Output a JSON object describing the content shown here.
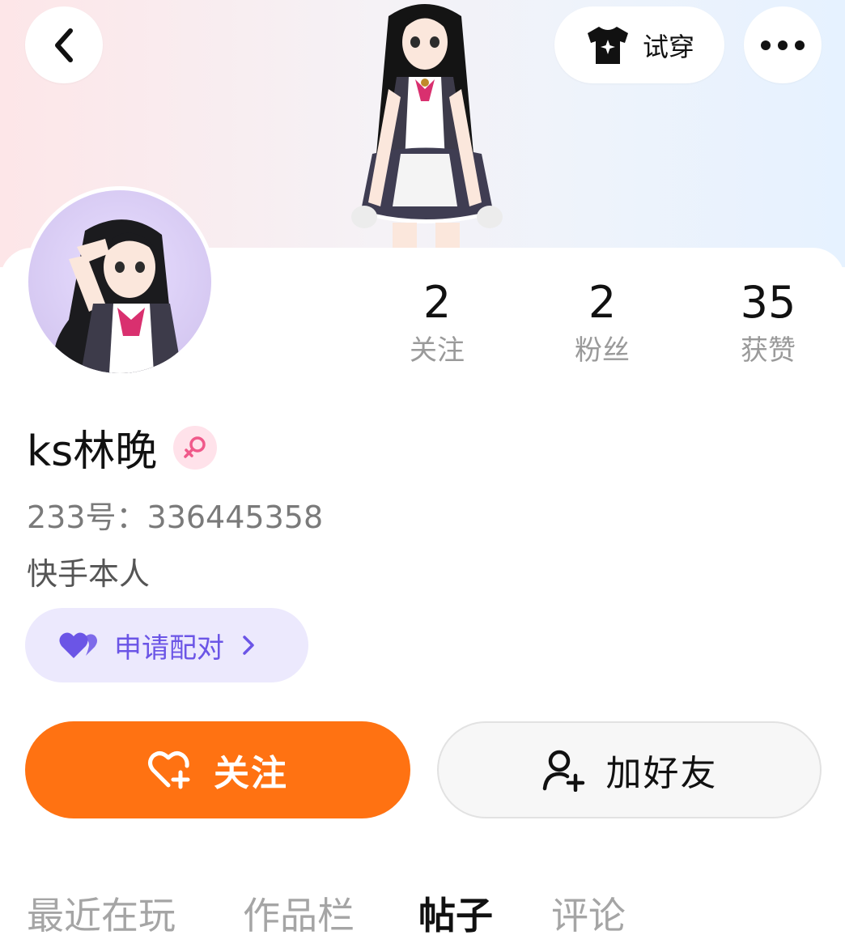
{
  "header": {
    "try_on_label": "试穿"
  },
  "stats": [
    {
      "value": "2",
      "label": "关注"
    },
    {
      "value": "2",
      "label": "粉丝"
    },
    {
      "value": "35",
      "label": "获赞"
    }
  ],
  "profile": {
    "username": "ks林晚",
    "uid_line": "233号：336445358",
    "bio": "快手本人"
  },
  "pair_chip": {
    "label": "申请配对"
  },
  "actions": {
    "follow_label": "关注",
    "add_friend_label": "加好友"
  },
  "tabs": [
    {
      "label": "最近在玩"
    },
    {
      "label": "作品栏"
    },
    {
      "label": "帖子"
    },
    {
      "label": "评论"
    }
  ],
  "colors": {
    "accent": "#ff7212",
    "pair_bg": "#ece9fd",
    "pair_text": "#6b55e6",
    "female_badge": "#ffe2ea"
  },
  "icons": [
    "back-icon",
    "tshirt-icon",
    "more-icon",
    "female-icon",
    "heart-pair-icon",
    "chevron-right-icon",
    "heart-plus-icon",
    "user-plus-icon"
  ]
}
